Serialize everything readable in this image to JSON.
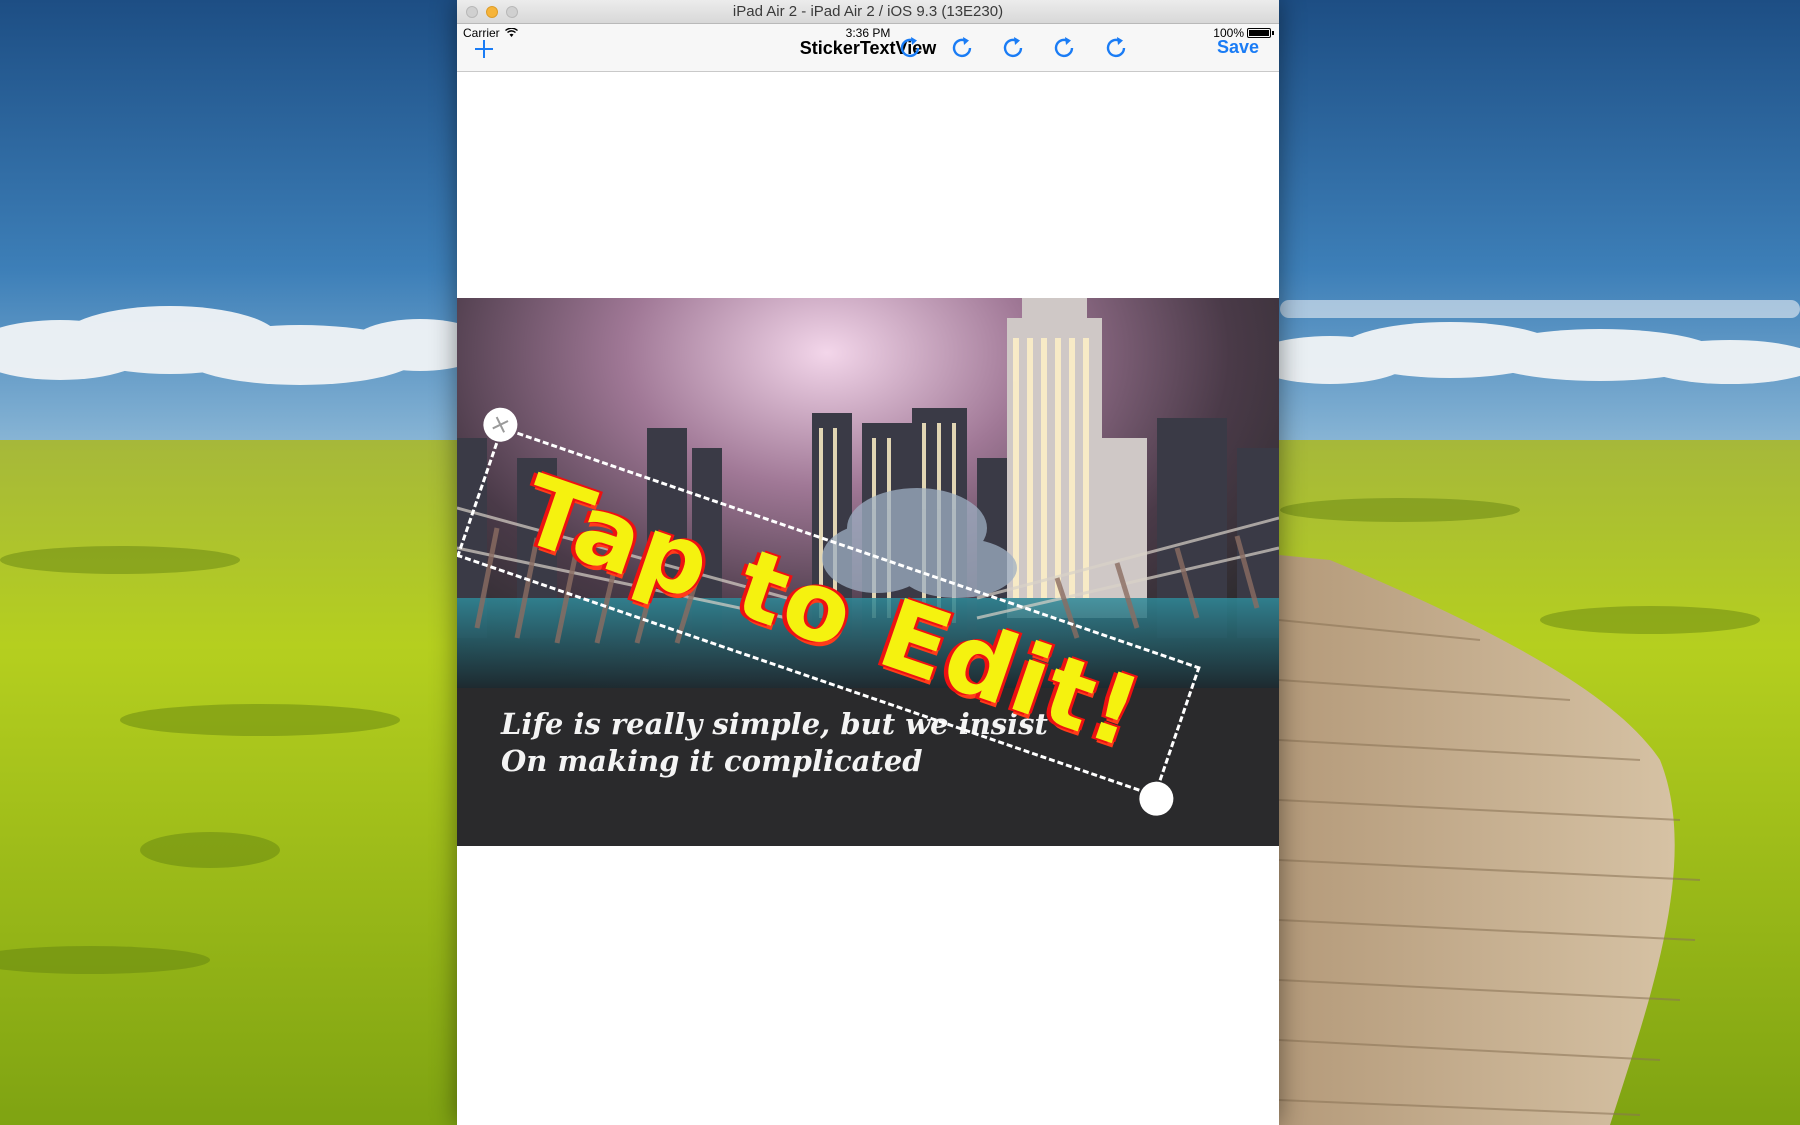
{
  "window": {
    "title": "iPad Air 2 - iPad Air 2 / iOS 9.3 (13E230)"
  },
  "status_bar": {
    "carrier": "Carrier",
    "time": "3:36 PM",
    "battery": "100%"
  },
  "navbar": {
    "add_icon": "plus-icon",
    "title": "StickerTextView",
    "redo_icons": [
      "redo-icon",
      "redo-icon",
      "redo-icon",
      "redo-icon",
      "redo-icon"
    ],
    "save_label": "Save",
    "accent_color": "#1a7cf5"
  },
  "canvas": {
    "sticker_text": "Tap to Edit!",
    "sticker_fill_color": "#f5f20f",
    "sticker_outline_color": "#ee1111",
    "quote_line1": "Life is really simple, but we insist",
    "quote_line2": "On making it complicated"
  }
}
